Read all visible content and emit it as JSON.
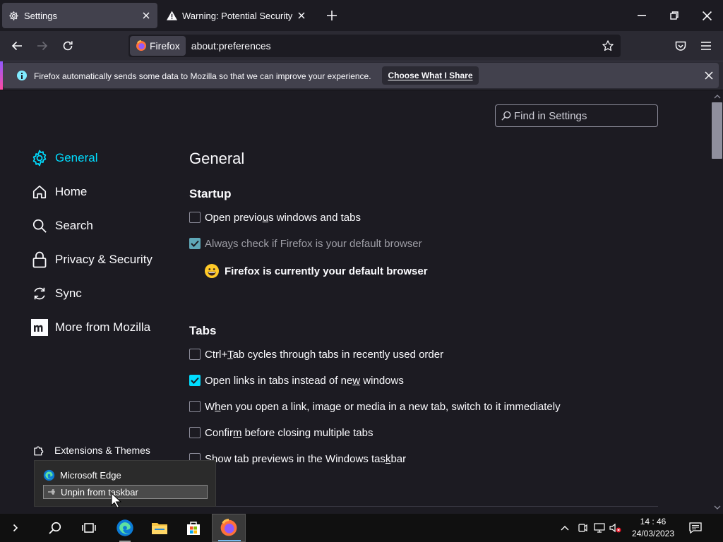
{
  "tabs": [
    {
      "title": "Settings",
      "icon": "gear-icon",
      "active": true
    },
    {
      "title": "Warning: Potential Security Risk",
      "icon": "warning-icon",
      "active": false
    }
  ],
  "navbar": {
    "identity_label": "Firefox",
    "url": "about:preferences"
  },
  "notification": {
    "message": "Firefox automatically sends some data to Mozilla so that we can improve your experience.",
    "button_label": "Choose What I Share"
  },
  "search": {
    "placeholder": "Find in Settings"
  },
  "sidebar": {
    "items": [
      {
        "label": "General",
        "icon": "gear-icon",
        "selected": true
      },
      {
        "label": "Home",
        "icon": "home-icon"
      },
      {
        "label": "Search",
        "icon": "search-icon"
      },
      {
        "label": "Privacy & Security",
        "icon": "lock-icon"
      },
      {
        "label": "Sync",
        "icon": "sync-icon"
      },
      {
        "label": "More from Mozilla",
        "icon": "mozilla-icon"
      }
    ],
    "extensions_label": "Extensions & Themes"
  },
  "main": {
    "title": "General",
    "startup": {
      "heading": "Startup",
      "open_previous": {
        "pre": "Open previo",
        "u": "u",
        "post": "s windows and tabs",
        "checked": false
      },
      "always_check": {
        "pre": "Alwa",
        "u": "y",
        "post": "s check if Firefox is your default browser",
        "checked": true,
        "disabled": true
      },
      "default_message": "Firefox is currently your default browser"
    },
    "tabs_section": {
      "heading": "Tabs",
      "items": [
        {
          "pre": "Ctrl+",
          "u": "T",
          "post": "ab cycles through tabs in recently used order",
          "checked": false
        },
        {
          "pre": "Open links in tabs instead of ne",
          "u": "w",
          "post": " windows",
          "checked": true
        },
        {
          "pre": "W",
          "u": "h",
          "post": "en you open a link, image or media in a new tab, switch to it immediately",
          "checked": false
        },
        {
          "pre": "Confir",
          "u": "m",
          "post": " before closing multiple tabs",
          "checked": false
        },
        {
          "pre": "Show tab previews in the Windows tas",
          "u": "k",
          "post": "bar",
          "checked": false
        }
      ]
    }
  },
  "jumplist": {
    "app_name": "Microsoft Edge",
    "unpin_label": "Unpin from taskbar"
  },
  "taskbar": {
    "time": "14 : 46",
    "date": "24/03/2023"
  },
  "colors": {
    "accent": "#00ddff",
    "background": "#1c1b22",
    "toolbar": "#2b2a33"
  }
}
